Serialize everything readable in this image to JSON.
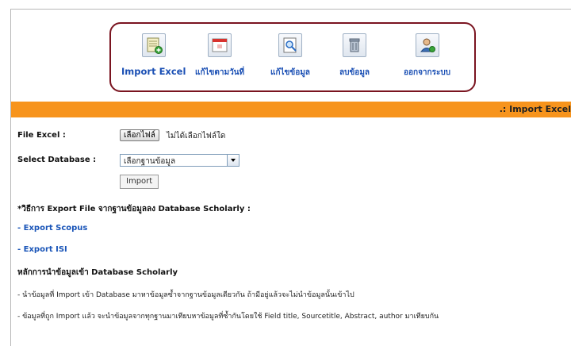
{
  "toolbar": {
    "items": [
      {
        "label": "Import Excel",
        "icon": "excel-icon"
      },
      {
        "label": "แก้ไขตามวันที่",
        "icon": "calendar-icon"
      },
      {
        "label": "แก้ไขข้อมูล",
        "icon": "edit-search-icon"
      },
      {
        "label": "ลบข้อมูล",
        "icon": "trash-icon"
      },
      {
        "label": "ออกจากระบบ",
        "icon": "logout-user-icon"
      }
    ]
  },
  "section": {
    "title": ".: Import Excel"
  },
  "form": {
    "file_label": "File Excel :",
    "file_button": "เลือกไฟล์",
    "file_status": "ไม่ได้เลือกไฟล์ใด",
    "db_label": "Select Database :",
    "db_selected": "เลือกฐานข้อมูล",
    "import_button": "Import"
  },
  "instructions": {
    "heading": "*วิธีการ Export File จากฐานข้อมูลลง Database Scholarly :",
    "link_scopus": "- Export Scopus",
    "link_isi": "- Export ISI",
    "principles_heading": "หลักการนำข้อมูลเข้า Database Scholarly",
    "rule1": "- นำข้อมูลที่ Import เข้า Database มาหาข้อมูลซ้ำจากฐานข้อมูลเดียวกัน ถ้ามีอยู่แล้วจะไม่นำข้อมูลนั้นเข้าไป",
    "rule2": "- ข้อมูลที่ถูก Import แล้ว จะนำข้อมูลจากทุกฐานมาเทียบหาข้อมูลที่ซ้ำกันโดยใช้ Field title, Sourcetitle, Abstract, author มาเทียบกัน"
  },
  "colors": {
    "accent": "#f7941d",
    "link": "#1a55b8",
    "toolbar_border": "#7a1420"
  }
}
